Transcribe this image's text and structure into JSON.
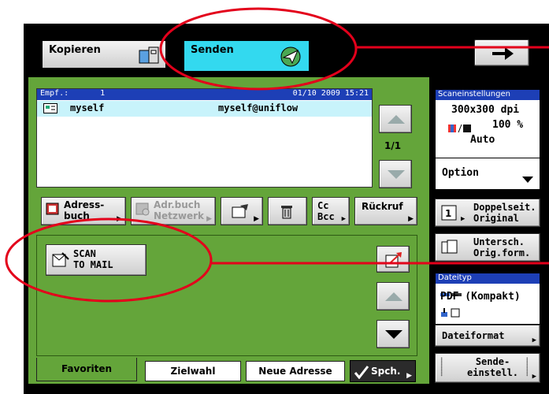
{
  "tabs": {
    "kopieren": "Kopieren",
    "senden": "Senden"
  },
  "recipients": {
    "header_left": "Empf.:",
    "header_count": "1",
    "header_datetime": "01/10 2009 15:21",
    "rows": [
      {
        "name": "myself",
        "address": "myself@uniflow"
      }
    ],
    "page": "1/1"
  },
  "toolbar": {
    "adressbuch": [
      "Adress-",
      "buch"
    ],
    "adrbuch_netzwerk": [
      "Adr.buch",
      "Netzwerk"
    ],
    "cc_bcc": [
      "Cc",
      "Bcc"
    ],
    "rueckruf": "Rückruf"
  },
  "favorites": {
    "scan_to_mail": [
      "SCAN",
      "TO MAIL"
    ]
  },
  "bottom_tabs": {
    "favoriten": "Favoriten",
    "zielwahl": "Zielwahl",
    "neue_adresse": "Neue Adresse",
    "speichern": "Spch."
  },
  "scan_settings": {
    "title": "Scaneinstellungen",
    "resolution": "300x300 dpi",
    "zoom": "100 %",
    "auto": "Auto",
    "option": "Option"
  },
  "right_buttons": {
    "doppelseit": [
      "Doppelseit.",
      "Original"
    ],
    "untersch": [
      "Untersch.",
      "Orig.form."
    ]
  },
  "dateityp": {
    "title": "Dateityp",
    "value": "PDF (Kompakt)",
    "dateiformat": "Dateiformat",
    "sende_einstell": [
      "Sende-",
      "einstell."
    ]
  },
  "colors": {
    "green": "#64a53a",
    "cyan_tab": "#33d9ef",
    "annotation_red": "#e3001b",
    "header_blue": "#1d3fb6"
  }
}
